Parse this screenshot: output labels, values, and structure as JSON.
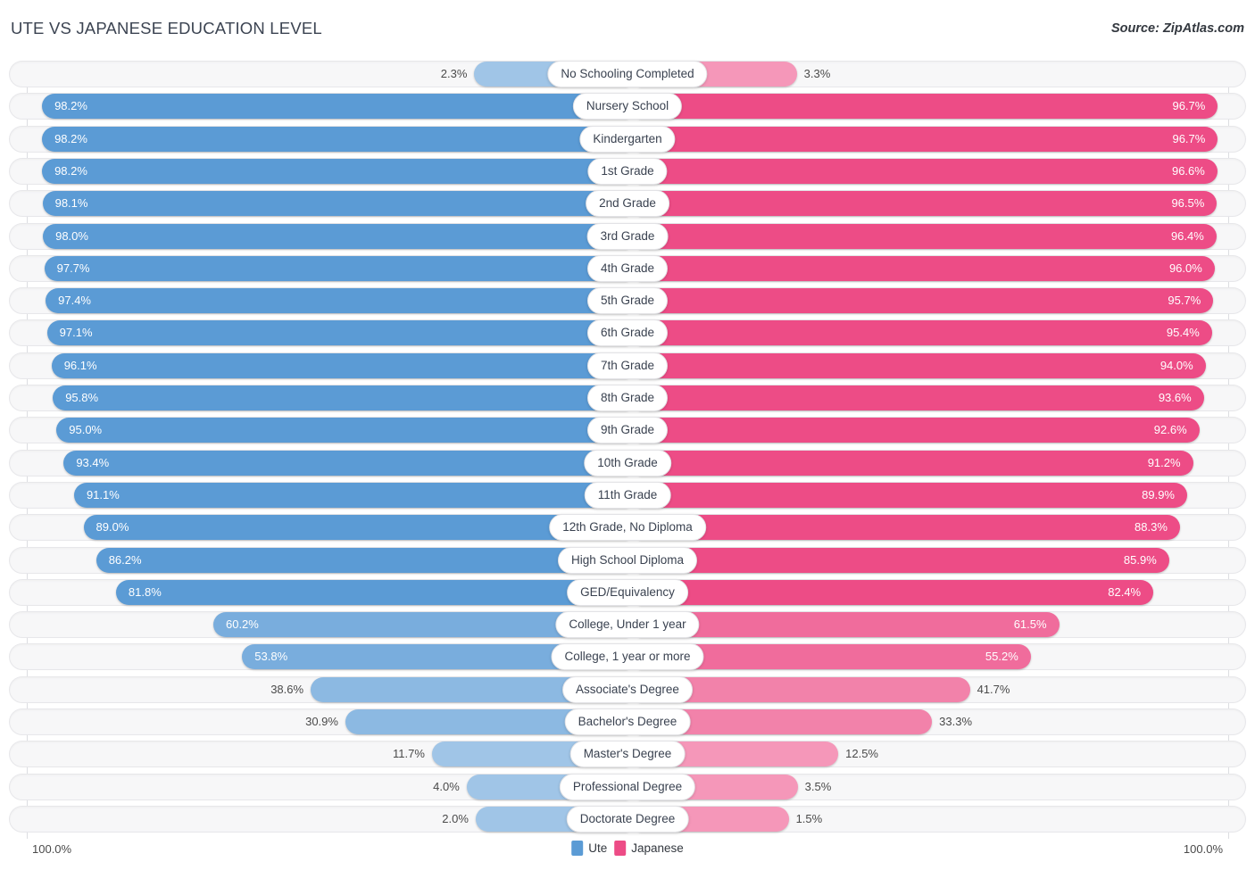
{
  "header": {
    "title": "Ute vs Japanese Education Level",
    "source": "Source: ZipAtlas.com"
  },
  "legend": {
    "left_axis_label": "100.0%",
    "right_axis_label": "100.0%",
    "series": [
      {
        "name": "Ute",
        "color": "#5b9bd5"
      },
      {
        "name": "Japanese",
        "color": "#ed4c86"
      }
    ]
  },
  "chart_data": {
    "type": "bar",
    "subtype": "diverging-bidirectional-bar",
    "title": "Ute vs Japanese Education Level",
    "xlabel": "",
    "ylabel": "",
    "xlim": [
      100,
      100
    ],
    "grid": true,
    "legend_position": "bottom-center",
    "categories": [
      "No Schooling Completed",
      "Nursery School",
      "Kindergarten",
      "1st Grade",
      "2nd Grade",
      "3rd Grade",
      "4th Grade",
      "5th Grade",
      "6th Grade",
      "7th Grade",
      "8th Grade",
      "9th Grade",
      "10th Grade",
      "11th Grade",
      "12th Grade, No Diploma",
      "High School Diploma",
      "GED/Equivalency",
      "College, Under 1 year",
      "College, 1 year or more",
      "Associate's Degree",
      "Bachelor's Degree",
      "Master's Degree",
      "Professional Degree",
      "Doctorate Degree"
    ],
    "series": [
      {
        "name": "Ute",
        "color": "#5b9bd5",
        "side": "left",
        "values": [
          2.3,
          98.2,
          98.2,
          98.2,
          98.1,
          98.0,
          97.7,
          97.4,
          97.1,
          96.1,
          95.8,
          95.0,
          93.4,
          91.1,
          89.0,
          86.2,
          81.8,
          60.2,
          53.8,
          38.6,
          30.9,
          11.7,
          4.0,
          2.0
        ],
        "labels": [
          "2.3%",
          "98.2%",
          "98.2%",
          "98.2%",
          "98.1%",
          "98.0%",
          "97.7%",
          "97.4%",
          "97.1%",
          "96.1%",
          "95.8%",
          "95.0%",
          "93.4%",
          "91.1%",
          "89.0%",
          "86.2%",
          "81.8%",
          "60.2%",
          "53.8%",
          "38.6%",
          "30.9%",
          "11.7%",
          "4.0%",
          "2.0%"
        ]
      },
      {
        "name": "Japanese",
        "color": "#ed4c86",
        "side": "right",
        "values": [
          3.3,
          96.7,
          96.7,
          96.6,
          96.5,
          96.4,
          96.0,
          95.7,
          95.4,
          94.0,
          93.6,
          92.6,
          91.2,
          89.9,
          88.3,
          85.9,
          82.4,
          61.5,
          55.2,
          41.7,
          33.3,
          12.5,
          3.5,
          1.5
        ],
        "labels": [
          "3.3%",
          "96.7%",
          "96.7%",
          "96.6%",
          "96.5%",
          "96.4%",
          "96.0%",
          "95.7%",
          "95.4%",
          "94.0%",
          "93.6%",
          "92.6%",
          "91.2%",
          "89.9%",
          "88.3%",
          "85.9%",
          "82.4%",
          "61.5%",
          "55.2%",
          "41.7%",
          "33.3%",
          "12.5%",
          "3.5%",
          "1.5%"
        ]
      }
    ]
  }
}
